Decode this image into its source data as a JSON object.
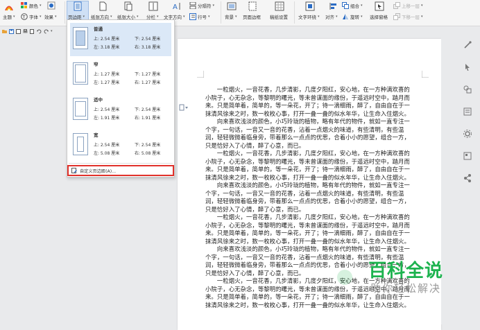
{
  "ribbon": {
    "theme": "主题",
    "color": "颜色",
    "font": "字体",
    "effect": "效果",
    "margins": "页边距",
    "orientation": "纸张方向",
    "size": "纸张大小",
    "columns": "分栏",
    "text_direction": "文字方向",
    "line_number": "行号",
    "breaks": "分隔符",
    "background": "背景",
    "page_border": "页面边框",
    "draft_settings": "稿纸设置",
    "text_wrap": "文字环绕",
    "align": "对齐",
    "group": "组合",
    "rotate": "旋转",
    "selection_pane": "选择窗格",
    "bring_forward": "上移一层",
    "send_backward": "下移一层"
  },
  "margins_menu": {
    "items": [
      {
        "name": "普通",
        "top": "上: 2.54 厘米",
        "bottom": "下: 2.54 厘米",
        "left": "左: 3.18 厘米",
        "right": "右: 3.18 厘米"
      },
      {
        "name": "窄",
        "top": "上: 1.27 厘米",
        "bottom": "下: 1.27 厘米",
        "left": "左: 1.27 厘米",
        "right": "右: 1.27 厘米"
      },
      {
        "name": "适中",
        "top": "上: 2.54 厘米",
        "bottom": "下: 2.54 厘米",
        "left": "左: 1.91 厘米",
        "right": "右: 1.91 厘米"
      },
      {
        "name": "宽",
        "top": "上: 2.54 厘米",
        "bottom": "下: 2.54 厘米",
        "left": "左: 5.08 厘米",
        "right": "右: 5.08 厘米"
      }
    ],
    "custom": "自定义页边距(A)..."
  },
  "document": {
    "paragraphs": [
      "一粒烟火，一音花香，几步清影，几度夕阳红，安心地，在一方种满欢喜的小院子，心无杂念，等黎明的曙光，等未曾谋面的缘份，于遥远时空中，踏月而来。只是简单着，简单的，等一朵花，开了；待一滴细雨，醉了，自由自在于一抹清风徐来之时，数一枚枚心事，打开一叠一叠的似水年华，让生命入住烟火。",
      "向来喜欢浅淡的颜色，小巧玲珑的植物，略有年代的物件，就如一直专注一个字，一句话，一音又一音的花香，沾着一点烟火的味道，有些清明，有些温润，轻轻微微着临身旁，带着那么一点点的优思，合着小小的愿望，组合一方，只是恰好入了心情，醉了心意，而已。",
      "一粒烟火，一音花香，几步清影，几度夕阳红，安心地，在一方种满欢喜的小院子，心无杂念，等黎明的曙光，等未曾谋面的缘份，于遥远时空中，踏月而来。只是简单着，简单的，等一朵花，开了；待一滴细雨，醉了，自由自在于一抹清风徐来之时，数一枚枚心事，打开一叠一叠的似水年华，让生命入住烟火。",
      "向来喜欢浅淡的颜色，小巧玲珑的植物，略有年代的物件，就如一直专注一个字，一句话，一音又一音的花香，沾着一点烟火的味道，有些清明，有些温润，轻轻微微着临身旁，带着那么一点点的优思，合着小小的愿望，组合一方，只是恰好入了心情，醉了心意，而已。",
      "一粒烟火，一音花香，几步清影，几度夕阳红，安心地，在一方种满欢喜的小院子，心无杂念，等黎明的曙光，等未曾谋面的缘份，于遥远时空中，踏月而来。只是简单着，简单的，等一朵花，开了；待一滴细雨，醉了，自由自在于一抹清风徐来之时，数一枚枚心事，打开一叠一叠的似水年华，让生命入住烟火。",
      "向来喜欢浅淡的颜色，小巧玲珑的植物，略有年代的物件，就如一直专注一个字，一句话，一音又一音的花香，沾着一点烟火的味道，有些清明，有些温润，轻轻微微着临身旁，带着那么一点点的优思，合着小小的愿望，组合一方，只是恰好入了心情，醉了心意，而已。",
      "一粒烟火，一音花香，几步清影，几度夕阳红，安心地，在一方种满欢喜的小院子，心无杂念，等黎明的曙光，等未曾谋面的缘份，于遥远时空中，踏月而来。只是简单着，简单的，等一朵花，开了；待一滴细雨，醉了，自由自在于一抹清风徐来之时，数一枚枚心事，打开一叠一叠的似水年华，让生命入住烟火。"
    ]
  },
  "watermark": {
    "main": "百科全说",
    "sub": "助你轻松解决"
  },
  "colors": {
    "accent": "#2b6cc4",
    "highlight": "#e0302a",
    "watermark_green": "#1db34f"
  }
}
